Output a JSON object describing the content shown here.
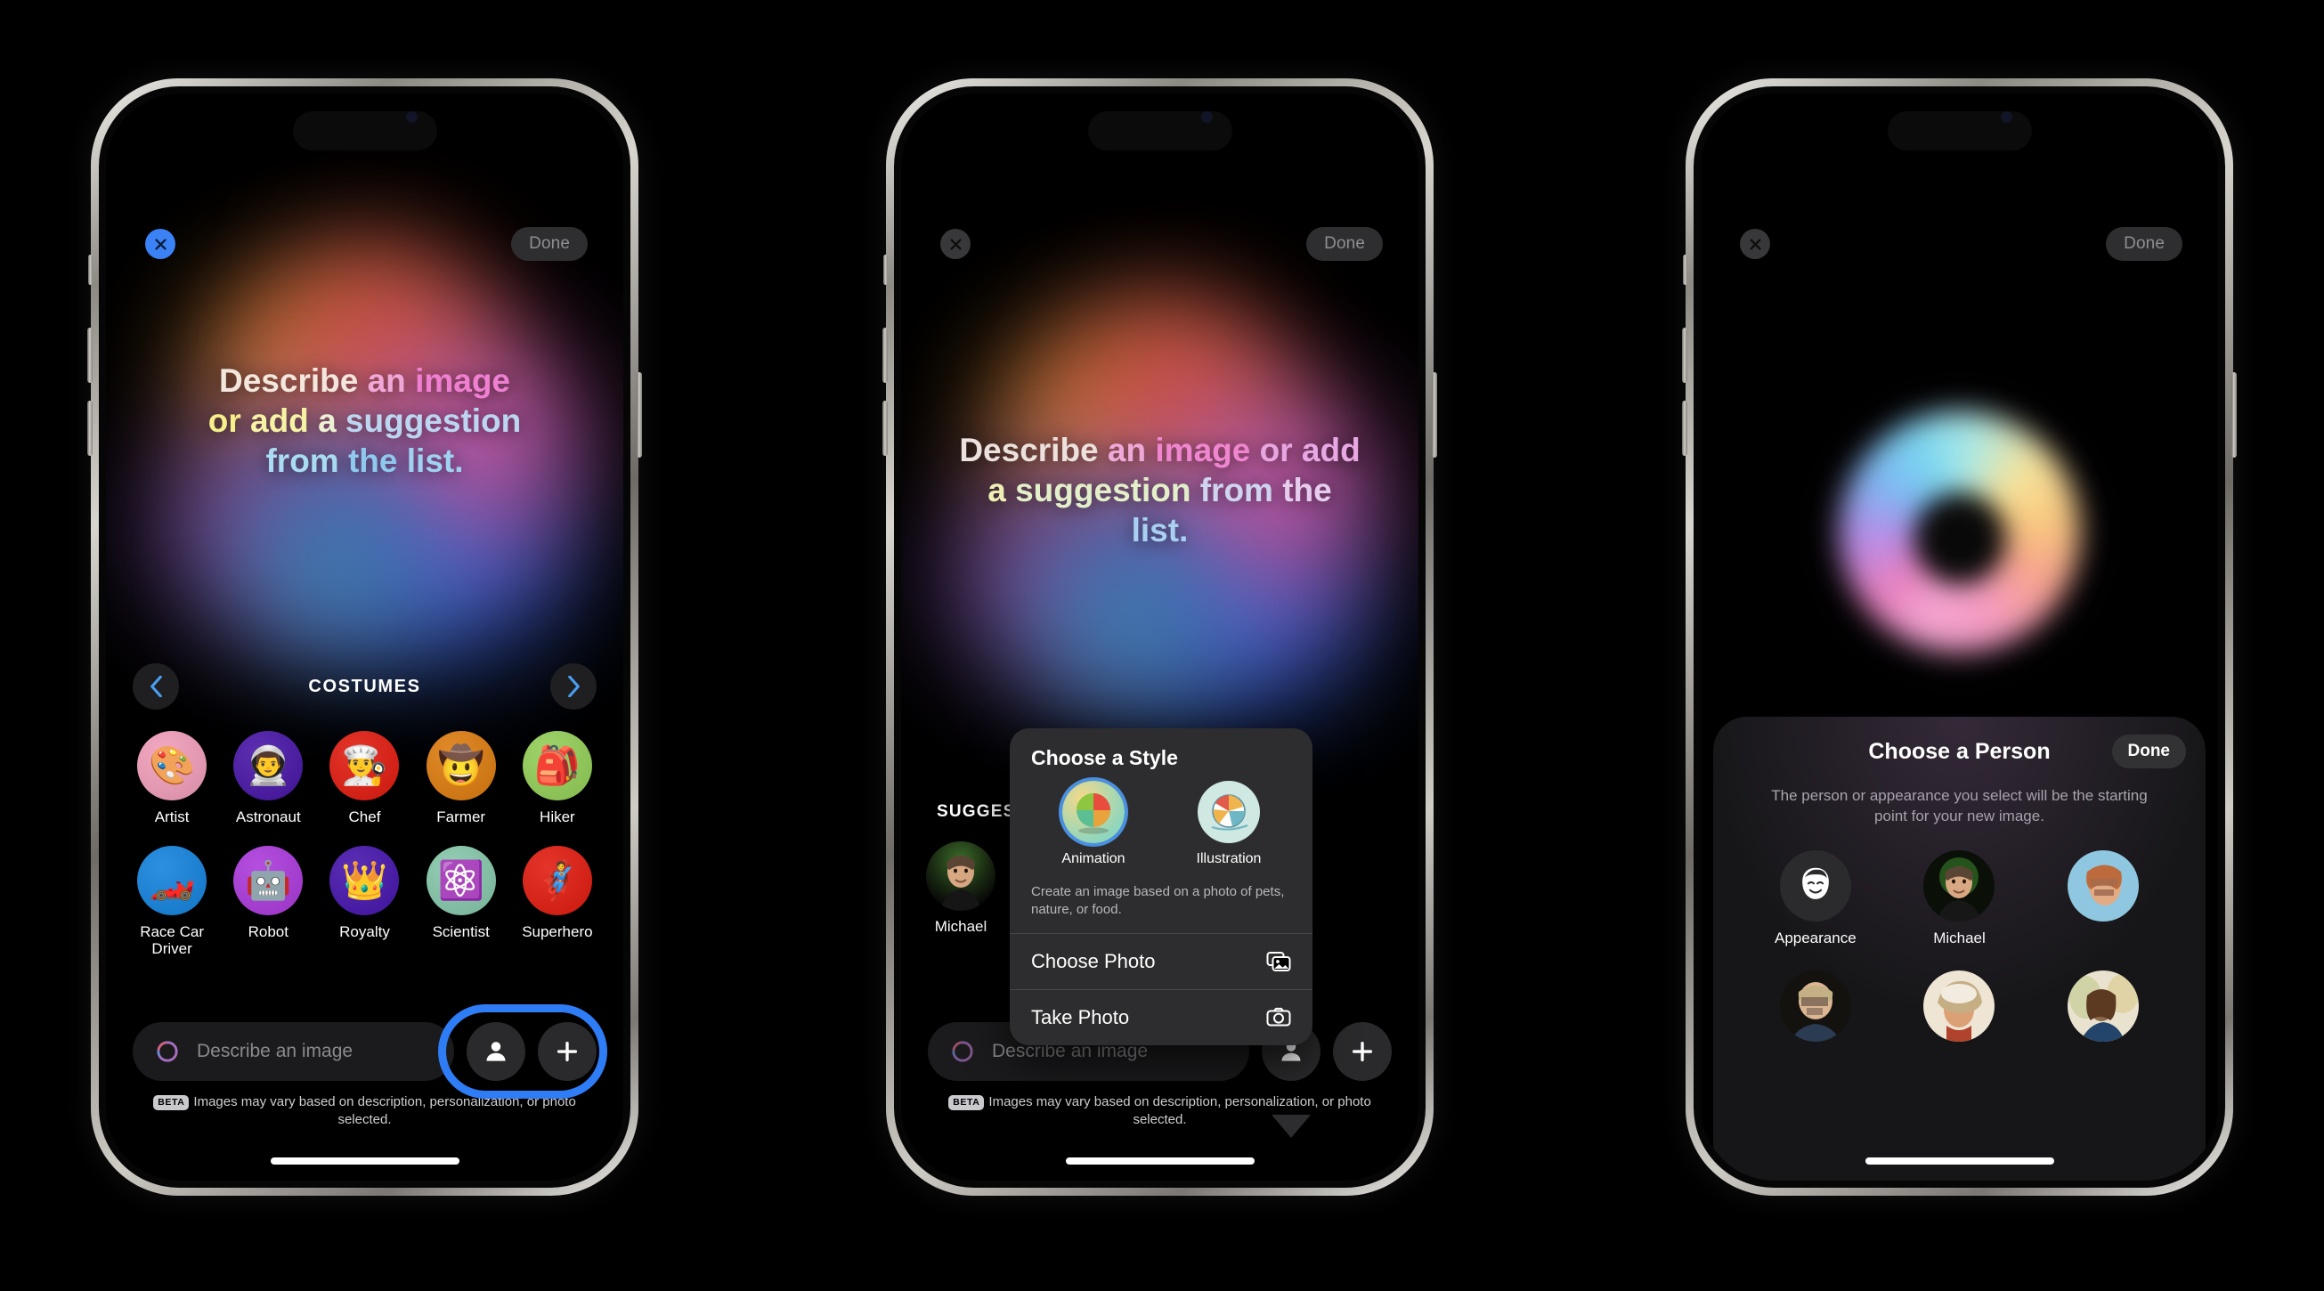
{
  "common": {
    "close_icon": "close-x-icon",
    "done_label": "Done",
    "input_placeholder": "Describe an image",
    "siri_icon": "siri-swirl-icon",
    "person_icon": "person-icon",
    "plus_icon": "plus-icon",
    "beta_badge": "BETA",
    "disclaimer": "Images may vary based on description, personalization, or photo selected.",
    "accent_blue": "#3b82f6",
    "highlight_ring_color": "#2f7df6"
  },
  "phone1": {
    "hero_lines": [
      [
        {
          "t": "Describe ",
          "c": "#f3e7dd"
        },
        {
          "t": "an ",
          "c": "#f0a8d8"
        },
        {
          "t": "image",
          "c": "#ef7fd0"
        }
      ],
      [
        {
          "t": "or ",
          "c": "#f5f08a"
        },
        {
          "t": "add ",
          "c": "#f7f3a4"
        },
        {
          "t": "a ",
          "c": "#eef1d5"
        },
        {
          "t": "suggestion",
          "c": "#bcd6f2"
        }
      ],
      [
        {
          "t": "from ",
          "c": "#a9dcf2"
        },
        {
          "t": "the ",
          "c": "#8fc9ee"
        },
        {
          "t": "list.",
          "c": "#9fd2f0"
        }
      ]
    ],
    "carousel": {
      "title": "COSTUMES",
      "prev_icon": "chevron-left-icon",
      "next_icon": "chevron-right-icon"
    },
    "costumes": [
      {
        "label": "Artist",
        "emoji": "🎨",
        "bg": "#f3a8c2"
      },
      {
        "label": "Astronaut",
        "emoji": "👨‍🚀",
        "bg": "#5b2fb0"
      },
      {
        "label": "Chef",
        "emoji": "👨‍🍳",
        "bg": "#e5342a"
      },
      {
        "label": "Farmer",
        "emoji": "🤠",
        "bg": "#e08a2a"
      },
      {
        "label": "Hiker",
        "emoji": "🎒",
        "bg": "#9ed46a"
      },
      {
        "label": "Race Car Driver",
        "emoji": "🏎️",
        "bg": "#2e90e0"
      },
      {
        "label": "Robot",
        "emoji": "🤖",
        "bg": "#b54fe0"
      },
      {
        "label": "Royalty",
        "emoji": "👑",
        "bg": "#5a2fb5"
      },
      {
        "label": "Scientist",
        "emoji": "⚛️",
        "bg": "#93ceb4"
      },
      {
        "label": "Superhero",
        "emoji": "🦸",
        "bg": "#e5342a"
      }
    ]
  },
  "phone2": {
    "hero_lines": [
      [
        {
          "t": "Describe ",
          "c": "#ece1dc"
        },
        {
          "t": "an ",
          "c": "#efa9d9"
        },
        {
          "t": "image ",
          "c": "#ef86cf"
        },
        {
          "t": "or ",
          "c": "#e8a6e0"
        },
        {
          "t": "add",
          "c": "#e7a8e4"
        }
      ],
      [
        {
          "t": "a ",
          "c": "#eef0b4"
        },
        {
          "t": "suggestion ",
          "c": "#e3efc9"
        },
        {
          "t": "from ",
          "c": "#cfd5ef"
        },
        {
          "t": "the",
          "c": "#e6cdee"
        }
      ],
      [
        {
          "t": "list.",
          "c": "#a9d0f0"
        }
      ]
    ],
    "suggestions_label": "SUGGESTIONS",
    "suggestions": [
      {
        "label": "Michael",
        "avatar": "michael-photo"
      },
      {
        "label": "",
        "avatar": "person-photo-2"
      }
    ],
    "popup": {
      "title": "Choose a Style",
      "styles": [
        {
          "label": "Animation",
          "icon": "animation-beachball-icon",
          "selected": true
        },
        {
          "label": "Illustration",
          "icon": "illustration-beachball-icon",
          "selected": false
        }
      ],
      "description": "Create an image based on a photo of pets, nature, or food.",
      "items": [
        {
          "label": "Choose Photo",
          "icon": "photos-library-icon"
        },
        {
          "label": "Take Photo",
          "icon": "camera-icon"
        }
      ]
    }
  },
  "phone3": {
    "sheet": {
      "title": "Choose a Person",
      "done_label": "Done",
      "subtitle": "The person or appearance you select will be the starting point for your new image.",
      "people": [
        {
          "label": "Appearance",
          "kind": "appearance-icon"
        },
        {
          "label": "Michael",
          "kind": "photo-michael"
        },
        {
          "label": "",
          "kind": "photo-person-3"
        },
        {
          "label": "",
          "kind": "photo-person-4"
        },
        {
          "label": "",
          "kind": "photo-person-5"
        },
        {
          "label": "",
          "kind": "photo-person-6"
        }
      ]
    }
  }
}
